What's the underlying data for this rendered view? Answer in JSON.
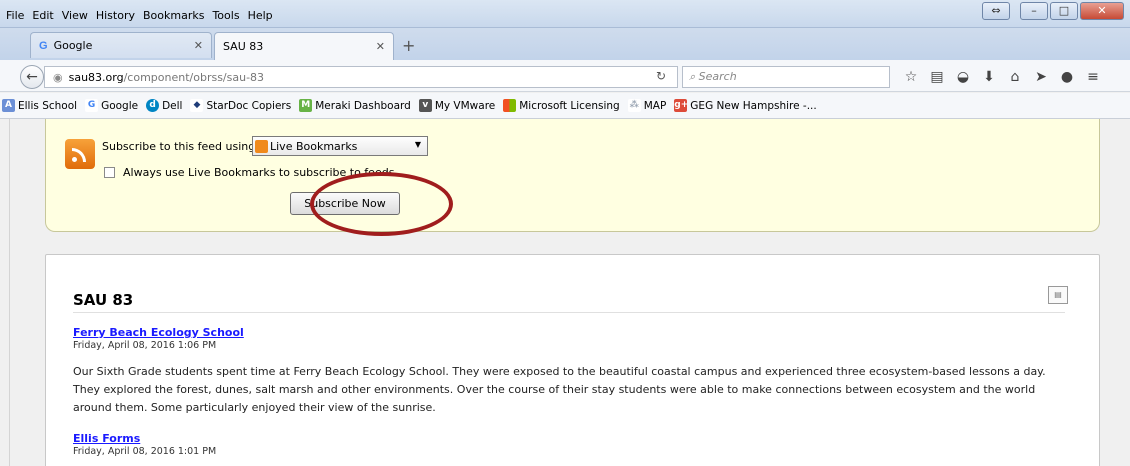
{
  "menu": [
    "File",
    "Edit",
    "View",
    "History",
    "Bookmarks",
    "Tools",
    "Help"
  ],
  "tabs": [
    {
      "label": "Google",
      "icon": "google-g-icon"
    },
    {
      "label": "SAU 83",
      "icon": "none"
    }
  ],
  "nav": {
    "url_host": "sau83.org",
    "url_path": "/component/obrss/sau-83",
    "search_placeholder": "Search"
  },
  "bookmarks": [
    {
      "label": "Ellis School",
      "color": "#6b8fd6"
    },
    {
      "label": "Google",
      "color": "#4285f4"
    },
    {
      "label": "Dell",
      "color": "#0085c3"
    },
    {
      "label": "StarDoc Copiers",
      "color": "#1e3c78"
    },
    {
      "label": "Meraki Dashboard",
      "color": "#67b346"
    },
    {
      "label": "My VMware",
      "color": "#555555"
    },
    {
      "label": "Microsoft Licensing",
      "color": "#f25022"
    },
    {
      "label": "MAP",
      "color": "#9aa5b3"
    },
    {
      "label": "GEG New Hampshire -...",
      "color": "#dd4b39"
    }
  ],
  "subscribe": {
    "label": "Subscribe to this feed using",
    "selected": "Live Bookmarks",
    "always_label": "Always use Live Bookmarks to subscribe to feeds.",
    "button": "Subscribe Now"
  },
  "feed": {
    "title": "SAU 83",
    "entries": [
      {
        "title": "Ferry Beach Ecology School",
        "date": "Friday, April 08, 2016 1:06 PM",
        "body": "Our Sixth Grade students spent time at Ferry Beach Ecology School. They were exposed to the beautiful coastal campus and experienced three ecosystem-based lessons a day. They explored the forest, dunes, salt marsh and other environments. Over the course of their stay students were able to make connections between ecosystem and the world around them. Some particularly enjoyed their view of the sunrise."
      },
      {
        "title": "Ellis Forms",
        "date": "Friday, April 08, 2016 1:01 PM",
        "body": ""
      }
    ]
  }
}
